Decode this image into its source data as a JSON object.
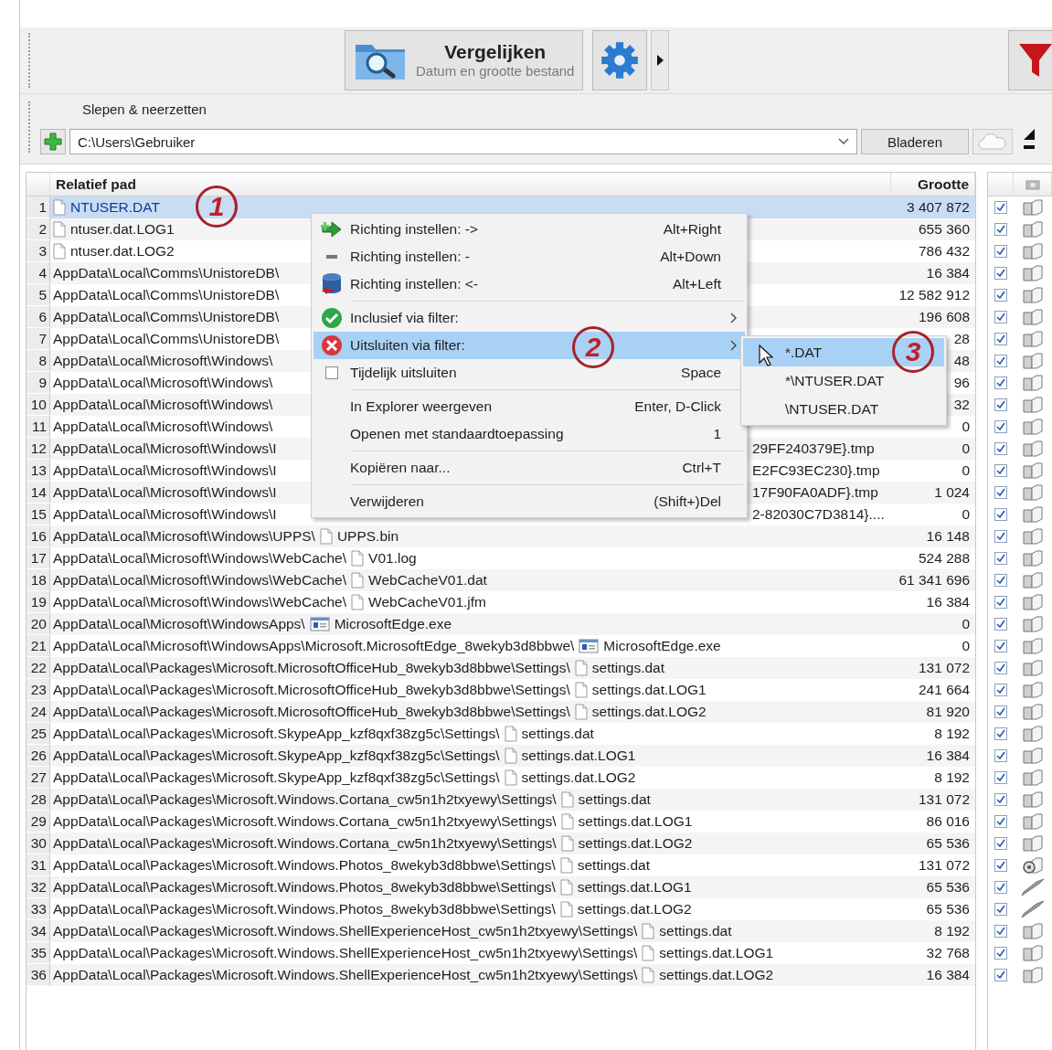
{
  "toolbar": {
    "compare_button": {
      "title": "Vergelijken",
      "subtitle": "Datum en grootte bestand"
    }
  },
  "folder_bar": {
    "label": "Slepen & neerzetten",
    "path": "C:\\Users\\Gebruiker",
    "browse_button": "Bladeren"
  },
  "table": {
    "columns": [
      "Relatief pad",
      "Grootte"
    ],
    "rows": [
      {
        "number": "1",
        "kind": "file",
        "file": "NTUSER.DAT",
        "size": "3 407 872",
        "selected": true,
        "checked": true,
        "action": {
          "kind": "copy"
        }
      },
      {
        "number": "2",
        "kind": "file",
        "file": "ntuser.dat.LOG1",
        "size": "655 360",
        "selected": false,
        "checked": true,
        "action": {
          "kind": "copy"
        }
      },
      {
        "number": "3",
        "kind": "file",
        "file": "ntuser.dat.LOG2",
        "size": "786 432",
        "selected": false,
        "checked": true,
        "action": {
          "kind": "copy"
        }
      },
      {
        "number": "4",
        "kind": "covered",
        "path": "AppData\\Local\\Comms\\UnistoreDB\\",
        "size": "16 384",
        "selected": false,
        "checked": true,
        "action": {
          "kind": "copy"
        }
      },
      {
        "number": "5",
        "kind": "covered",
        "path": "AppData\\Local\\Comms\\UnistoreDB\\",
        "size": "12 582 912",
        "selected": false,
        "checked": true,
        "action": {
          "kind": "copy"
        }
      },
      {
        "number": "6",
        "kind": "covered",
        "path": "AppData\\Local\\Comms\\UnistoreDB\\",
        "size": "196 608",
        "selected": false,
        "checked": true,
        "action": {
          "kind": "copy"
        }
      },
      {
        "number": "7",
        "kind": "covered",
        "path": "AppData\\Local\\Comms\\UnistoreDB\\",
        "size": "28",
        "selected": false,
        "checked": true,
        "action": {
          "kind": "copy"
        }
      },
      {
        "number": "8",
        "kind": "covered",
        "path": "AppData\\Local\\Microsoft\\Windows\\",
        "size": "48",
        "selected": false,
        "checked": true,
        "action": {
          "kind": "copy"
        }
      },
      {
        "number": "9",
        "kind": "covered",
        "path": "AppData\\Local\\Microsoft\\Windows\\",
        "size": "96",
        "selected": false,
        "checked": true,
        "action": {
          "kind": "copy"
        }
      },
      {
        "number": "10",
        "kind": "covered",
        "path": "AppData\\Local\\Microsoft\\Windows\\",
        "size": "32",
        "selected": false,
        "checked": true,
        "action": {
          "kind": "copy"
        }
      },
      {
        "number": "11",
        "kind": "covered",
        "path": "AppData\\Local\\Microsoft\\Windows\\",
        "size": "0",
        "selected": false,
        "checked": true,
        "action": {
          "kind": "copy"
        }
      },
      {
        "number": "12",
        "kind": "covered",
        "path": "AppData\\Local\\Microsoft\\Windows\\I",
        "tail": "29FF240379E}.tmp",
        "size": "0",
        "selected": false,
        "checked": true,
        "action": {
          "kind": "copy"
        }
      },
      {
        "number": "13",
        "kind": "covered",
        "path": "AppData\\Local\\Microsoft\\Windows\\I",
        "tail": "E2FC93EC230}.tmp",
        "size": "0",
        "selected": false,
        "checked": true,
        "action": {
          "kind": "copy"
        }
      },
      {
        "number": "14",
        "kind": "covered",
        "path": "AppData\\Local\\Microsoft\\Windows\\I",
        "tail": "17F90FA0ADF}.tmp",
        "size": "1 024",
        "selected": false,
        "checked": true,
        "action": {
          "kind": "copy"
        }
      },
      {
        "number": "15",
        "kind": "covered",
        "path": "AppData\\Local\\Microsoft\\Windows\\I",
        "tail": "2-82030C7D3814}....",
        "size": "0",
        "selected": false,
        "checked": true,
        "action": {
          "kind": "copy"
        }
      },
      {
        "number": "16",
        "kind": "file",
        "path": "AppData\\Local\\Microsoft\\Windows\\UPPS\\",
        "file": "UPPS.bin",
        "size": "16 148",
        "selected": false,
        "checked": true,
        "action": {
          "kind": "copy"
        }
      },
      {
        "number": "17",
        "kind": "file",
        "path": "AppData\\Local\\Microsoft\\Windows\\WebCache\\",
        "file": "V01.log",
        "size": "524 288",
        "selected": false,
        "checked": true,
        "action": {
          "kind": "copy"
        }
      },
      {
        "number": "18",
        "kind": "file",
        "path": "AppData\\Local\\Microsoft\\Windows\\WebCache\\",
        "file": "WebCacheV01.dat",
        "size": "61 341 696",
        "selected": false,
        "checked": true,
        "action": {
          "kind": "copy"
        }
      },
      {
        "number": "19",
        "kind": "file",
        "path": "AppData\\Local\\Microsoft\\Windows\\WebCache\\",
        "file": "WebCacheV01.jfm",
        "size": "16 384",
        "selected": false,
        "checked": true,
        "action": {
          "kind": "copy"
        }
      },
      {
        "number": "20",
        "kind": "app",
        "path": "AppData\\Local\\Microsoft\\WindowsApps\\",
        "file": "MicrosoftEdge.exe",
        "size": "0",
        "selected": false,
        "checked": true,
        "action": {
          "kind": "copy"
        }
      },
      {
        "number": "21",
        "kind": "app",
        "path": "AppData\\Local\\Microsoft\\WindowsApps\\Microsoft.MicrosoftEdge_8wekyb3d8bbwe\\",
        "file": "MicrosoftEdge.exe",
        "size": "0",
        "selected": false,
        "checked": true,
        "action": {
          "kind": "copy"
        }
      },
      {
        "number": "22",
        "kind": "file",
        "path": "AppData\\Local\\Packages\\Microsoft.MicrosoftOfficeHub_8wekyb3d8bbwe\\Settings\\",
        "file": "settings.dat",
        "size": "131 072",
        "selected": false,
        "checked": true,
        "action": {
          "kind": "copy"
        }
      },
      {
        "number": "23",
        "kind": "file",
        "path": "AppData\\Local\\Packages\\Microsoft.MicrosoftOfficeHub_8wekyb3d8bbwe\\Settings\\",
        "file": "settings.dat.LOG1",
        "size": "241 664",
        "selected": false,
        "checked": true,
        "action": {
          "kind": "copy"
        }
      },
      {
        "number": "24",
        "kind": "file",
        "path": "AppData\\Local\\Packages\\Microsoft.MicrosoftOfficeHub_8wekyb3d8bbwe\\Settings\\",
        "file": "settings.dat.LOG2",
        "size": "81 920",
        "selected": false,
        "checked": true,
        "action": {
          "kind": "copy"
        }
      },
      {
        "number": "25",
        "kind": "file",
        "path": "AppData\\Local\\Packages\\Microsoft.SkypeApp_kzf8qxf38zg5c\\Settings\\",
        "file": "settings.dat",
        "size": "8 192",
        "selected": false,
        "checked": true,
        "action": {
          "kind": "copy"
        }
      },
      {
        "number": "26",
        "kind": "file",
        "path": "AppData\\Local\\Packages\\Microsoft.SkypeApp_kzf8qxf38zg5c\\Settings\\",
        "file": "settings.dat.LOG1",
        "size": "16 384",
        "selected": false,
        "checked": true,
        "action": {
          "kind": "copy"
        }
      },
      {
        "number": "27",
        "kind": "file",
        "path": "AppData\\Local\\Packages\\Microsoft.SkypeApp_kzf8qxf38zg5c\\Settings\\",
        "file": "settings.dat.LOG2",
        "size": "8 192",
        "selected": false,
        "checked": true,
        "action": {
          "kind": "copy"
        }
      },
      {
        "number": "28",
        "kind": "file",
        "path": "AppData\\Local\\Packages\\Microsoft.Windows.Cortana_cw5n1h2txyewy\\Settings\\",
        "file": "settings.dat",
        "size": "131 072",
        "selected": false,
        "checked": true,
        "action": {
          "kind": "copy"
        }
      },
      {
        "number": "29",
        "kind": "file",
        "path": "AppData\\Local\\Packages\\Microsoft.Windows.Cortana_cw5n1h2txyewy\\Settings\\",
        "file": "settings.dat.LOG1",
        "size": "86 016",
        "selected": false,
        "checked": true,
        "action": {
          "kind": "copy"
        }
      },
      {
        "number": "30",
        "kind": "file",
        "path": "AppData\\Local\\Packages\\Microsoft.Windows.Cortana_cw5n1h2txyewy\\Settings\\",
        "file": "settings.dat.LOG2",
        "size": "65 536",
        "selected": false,
        "checked": true,
        "action": {
          "kind": "copy"
        }
      },
      {
        "number": "31",
        "kind": "file",
        "path": "AppData\\Local\\Packages\\Microsoft.Windows.Photos_8wekyb3d8bbwe\\Settings\\",
        "file": "settings.dat",
        "size": "131 072",
        "selected": false,
        "checked": true,
        "action": {
          "kind": "disc"
        }
      },
      {
        "number": "32",
        "kind": "file",
        "path": "AppData\\Local\\Packages\\Microsoft.Windows.Photos_8wekyb3d8bbwe\\Settings\\",
        "file": "settings.dat.LOG1",
        "size": "65 536",
        "selected": false,
        "checked": true,
        "action": {
          "kind": "slash"
        }
      },
      {
        "number": "33",
        "kind": "file",
        "path": "AppData\\Local\\Packages\\Microsoft.Windows.Photos_8wekyb3d8bbwe\\Settings\\",
        "file": "settings.dat.LOG2",
        "size": "65 536",
        "selected": false,
        "checked": true,
        "action": {
          "kind": "slash"
        }
      },
      {
        "number": "34",
        "kind": "file",
        "path": "AppData\\Local\\Packages\\Microsoft.Windows.ShellExperienceHost_cw5n1h2txyewy\\Settings\\",
        "file": "settings.dat",
        "size": "8 192",
        "selected": false,
        "checked": true,
        "action": {
          "kind": "copy"
        }
      },
      {
        "number": "35",
        "kind": "file",
        "path": "AppData\\Local\\Packages\\Microsoft.Windows.ShellExperienceHost_cw5n1h2txyewy\\Settings\\",
        "file": "settings.dat.LOG1",
        "size": "32 768",
        "selected": false,
        "checked": true,
        "action": {
          "kind": "copy"
        }
      },
      {
        "number": "36",
        "kind": "file",
        "path": "AppData\\Local\\Packages\\Microsoft.Windows.ShellExperienceHost_cw5n1h2txyewy\\Settings\\",
        "file": "settings.dat.LOG2",
        "size": "16 384",
        "selected": false,
        "checked": true,
        "action": {
          "kind": "copy"
        }
      }
    ]
  },
  "context_menu": {
    "items": [
      {
        "kind": "right",
        "label": "Richting instellen: ->",
        "shortcut": "Alt+Right",
        "selected": false
      },
      {
        "kind": "equal",
        "label": "Richting instellen: -",
        "shortcut": "Alt+Down",
        "selected": false
      },
      {
        "kind": "left",
        "label": "Richting instellen: <-",
        "shortcut": "Alt+Left",
        "selected": false
      },
      {
        "kind": "include",
        "label": "Inclusief via filter:",
        "submenu": true,
        "separator_before": true,
        "selected": false
      },
      {
        "kind": "exclude",
        "label": "Uitsluiten via filter:",
        "submenu": true,
        "selected": true
      },
      {
        "kind": "toggle",
        "label": "Tijdelijk uitsluiten",
        "shortcut": "Space",
        "checked": false,
        "selected": false
      },
      {
        "kind": "plain",
        "label": "In Explorer weergeven",
        "shortcut": "Enter, D-Click",
        "separator_before": true,
        "selected": false
      },
      {
        "kind": "plain",
        "label": "Openen met standaardtoepassing",
        "shortcut": "1",
        "selected": false
      },
      {
        "kind": "plain",
        "label": "Kopiëren naar...",
        "shortcut": "Ctrl+T",
        "separator_before": true,
        "selected": false
      },
      {
        "kind": "plain",
        "label": "Verwijderen",
        "shortcut": "(Shift+)Del",
        "separator_before": true,
        "selected": false
      }
    ],
    "submenu": {
      "items": [
        {
          "label": "*.DAT",
          "selected": true
        },
        {
          "label": "*\\NTUSER.DAT",
          "selected": false
        },
        {
          "label": "\\NTUSER.DAT",
          "selected": false
        }
      ]
    }
  },
  "annotations": [
    "1",
    "2",
    "3"
  ]
}
